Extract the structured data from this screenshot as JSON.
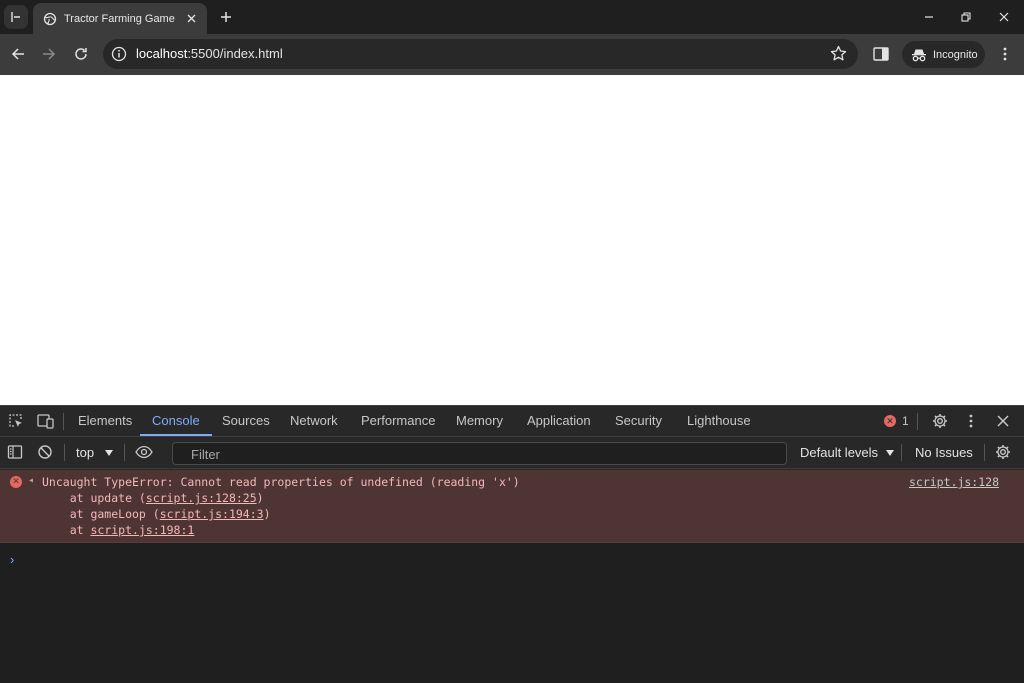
{
  "browser": {
    "tab": {
      "title": "Tractor Farming Game"
    },
    "address": {
      "host": "localhost",
      "rest": ":5500/index.html"
    },
    "incognito_label": "Incognito"
  },
  "devtools": {
    "tabs": [
      "Elements",
      "Console",
      "Sources",
      "Network",
      "Performance",
      "Memory",
      "Application",
      "Security",
      "Lighthouse"
    ],
    "active_tab": "Console",
    "error_count": "1",
    "context": "top",
    "filter_placeholder": "Filter",
    "levels": "Default levels",
    "issues": "No Issues"
  },
  "console": {
    "error": {
      "message_prefix": "Uncaught TypeError: Cannot read properties of undefined (reading 'x')",
      "source": "script.js:128",
      "stack": [
        {
          "prefix": "    at update (",
          "link": "script.js:128:25",
          "suffix": ")"
        },
        {
          "prefix": "    at gameLoop (",
          "link": "script.js:194:3",
          "suffix": ")"
        },
        {
          "prefix": "    at ",
          "link": "script.js:198:1",
          "suffix": ""
        }
      ]
    },
    "prompt": "›"
  },
  "colors": {
    "accent": "#7cacf8",
    "error": "#e46962",
    "error_bg": "#4e3534"
  }
}
